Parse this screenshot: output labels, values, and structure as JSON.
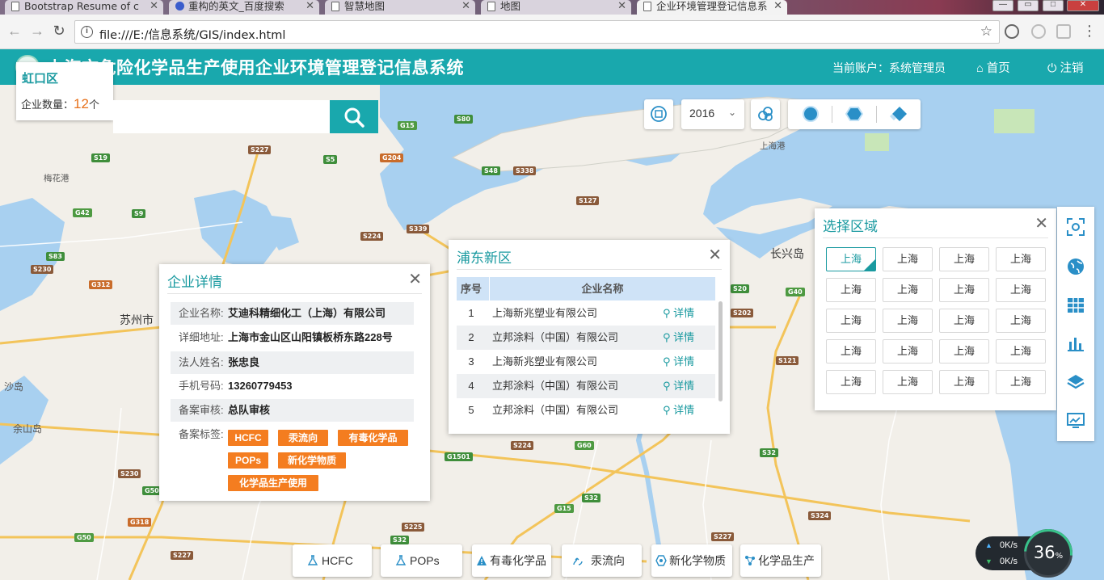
{
  "browser": {
    "tabs": [
      {
        "title": "Bootstrap Resume of c"
      },
      {
        "title": "重构的英文_百度搜索"
      },
      {
        "title": "智慧地图"
      },
      {
        "title": "地图"
      },
      {
        "title": "企业环境管理登记信息系"
      }
    ],
    "url": "file:///E:/信息系统/GIS/index.html"
  },
  "header": {
    "title": "上海市危险化学品生产使用企业环境管理登记信息系统",
    "account": "当前账户：系统管理员",
    "home": "首页",
    "logout": "注销"
  },
  "district_tooltip": {
    "name": "虹口区",
    "count_label": "企业数量：",
    "count": "12",
    "count_unit": "个"
  },
  "toolbar": {
    "year": "2016"
  },
  "company_detail": {
    "title": "企业详情",
    "rows": [
      {
        "key": "企业名称:",
        "value": "艾迪科精细化工（上海）有限公司"
      },
      {
        "key": "详细地址:",
        "value": "上海市金山区山阳镇板桥东路228号"
      },
      {
        "key": "法人姓名:",
        "value": "张忠良"
      },
      {
        "key": "手机号码:",
        "value": "13260779453"
      },
      {
        "key": "备案审核:",
        "value": "总队审核"
      }
    ],
    "tags_label": "备案标签:",
    "tags": [
      "HCFC",
      "汞流向",
      "有毒化学品",
      "POPs",
      "新化学物质",
      "化学品生产使用"
    ]
  },
  "district_list": {
    "title": "浦东新区",
    "columns": [
      "序号",
      "企业名称"
    ],
    "rows": [
      {
        "no": "1",
        "name": "上海新兆塑业有限公司",
        "action": "详情"
      },
      {
        "no": "2",
        "name": "立邦涂料（中国）有限公司",
        "action": "详情"
      },
      {
        "no": "3",
        "name": "上海新兆塑业有限公司",
        "action": "详情"
      },
      {
        "no": "4",
        "name": "立邦涂料（中国）有限公司",
        "action": "详情"
      },
      {
        "no": "5",
        "name": "立邦涂料（中国）有限公司",
        "action": "详情"
      }
    ]
  },
  "region_select": {
    "title": "选择区域",
    "options": [
      "上海",
      "上海",
      "上海",
      "上海",
      "上海",
      "上海",
      "上海",
      "上海",
      "上海",
      "上海",
      "上海",
      "上海",
      "上海",
      "上海",
      "上海",
      "上海",
      "上海",
      "上海",
      "上海",
      "上海"
    ],
    "selected_index": 0
  },
  "bottom_buttons": [
    {
      "label": "HCFC"
    },
    {
      "label": "POPs"
    },
    {
      "label": "有毒化学品"
    },
    {
      "label": "汞流向"
    },
    {
      "label": "新化学物质"
    },
    {
      "label": "化学品生产"
    }
  ],
  "network_widget": {
    "up": "0K/s",
    "down": "0K/s",
    "percent": "36",
    "percent_sign": "%"
  },
  "map_labels": {
    "places": [
      "苏州市",
      "长兴岛",
      "余山岛",
      "沙岛",
      "梅花港",
      "上海港"
    ],
    "roads": [
      "G15",
      "S80",
      "S19",
      "S5",
      "S227",
      "G204",
      "S48",
      "S338",
      "G42",
      "S9",
      "S127",
      "S339",
      "S224",
      "S83",
      "S230",
      "G312",
      "S20",
      "S202",
      "G40",
      "S121",
      "S32",
      "G60",
      "G1501",
      "S224",
      "S230",
      "G50",
      "G318",
      "S32",
      "S225",
      "G15",
      "S227",
      "S324",
      "S227",
      "G50",
      "S32"
    ]
  },
  "colors": {
    "brand": "#19a8ad",
    "tag": "#f47d20",
    "water": "#a8d0f0",
    "land": "#f2efe9"
  }
}
